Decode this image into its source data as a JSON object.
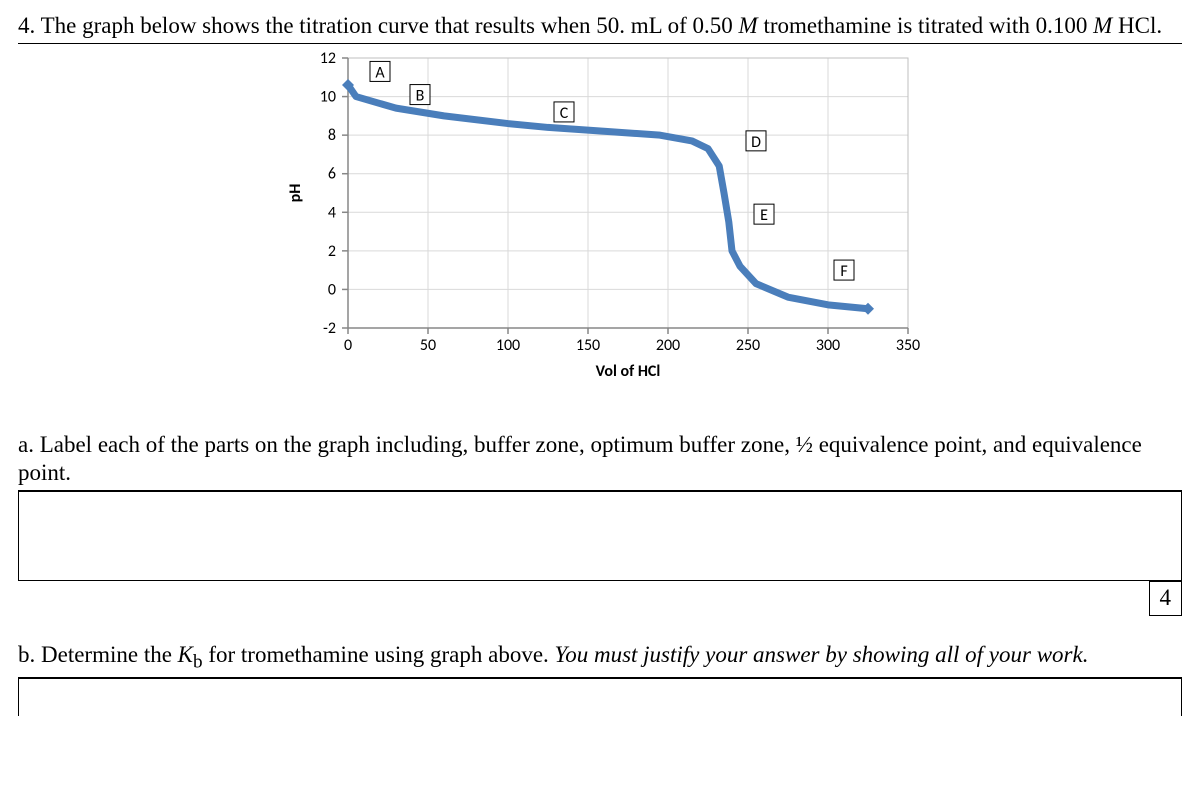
{
  "question": {
    "number": "4.",
    "stem_a": "The graph below shows the titration curve that results when 50. mL of 0.50 ",
    "stem_b": "tromethamine is titrated with 0.100 ",
    "stem_c": "HCl.",
    "M1": "M ",
    "M2": "M "
  },
  "sub_a": {
    "label": "a.",
    "text": "Label each of the parts on the graph including, buffer zone, optimum buffer zone, ½ equivalence point, and equivalence point."
  },
  "sub_b": {
    "label": "b.",
    "text_a": "Determine the ",
    "kb": "K",
    "kb_sub": "b",
    "text_b": " for tromethamine using graph above. ",
    "text_c": "You must justify your answer by showing all of your work."
  },
  "page_number": "4",
  "chart_data": {
    "type": "line",
    "xlabel": "Vol of HCl",
    "ylabel": "pH",
    "xlim": [
      0,
      350
    ],
    "ylim": [
      -2,
      12
    ],
    "x_ticks": [
      0,
      50,
      100,
      150,
      200,
      250,
      300,
      350
    ],
    "y_ticks": [
      -2,
      0,
      2,
      4,
      6,
      8,
      10,
      12
    ],
    "points": [
      {
        "x": 0,
        "y": 10.6
      },
      {
        "x": 5,
        "y": 10.0
      },
      {
        "x": 30,
        "y": 9.4
      },
      {
        "x": 60,
        "y": 9.0
      },
      {
        "x": 100,
        "y": 8.6
      },
      {
        "x": 125,
        "y": 8.4
      },
      {
        "x": 160,
        "y": 8.2
      },
      {
        "x": 195,
        "y": 8.0
      },
      {
        "x": 215,
        "y": 7.7
      },
      {
        "x": 225,
        "y": 7.3
      },
      {
        "x": 232,
        "y": 6.4
      },
      {
        "x": 235,
        "y": 5.0
      },
      {
        "x": 238,
        "y": 3.5
      },
      {
        "x": 240,
        "y": 2.0
      },
      {
        "x": 245,
        "y": 1.2
      },
      {
        "x": 255,
        "y": 0.3
      },
      {
        "x": 275,
        "y": -0.4
      },
      {
        "x": 300,
        "y": -0.8
      },
      {
        "x": 325,
        "y": -1.0
      }
    ],
    "labels": [
      {
        "name": "A",
        "x": 20,
        "y": 11.2
      },
      {
        "name": "B",
        "x": 45,
        "y": 10.0
      },
      {
        "name": "C",
        "x": 135,
        "y": 9.1
      },
      {
        "name": "D",
        "x": 255,
        "y": 7.6
      },
      {
        "name": "E",
        "x": 260,
        "y": 3.8
      },
      {
        "name": "F",
        "x": 310,
        "y": 0.9
      }
    ]
  }
}
